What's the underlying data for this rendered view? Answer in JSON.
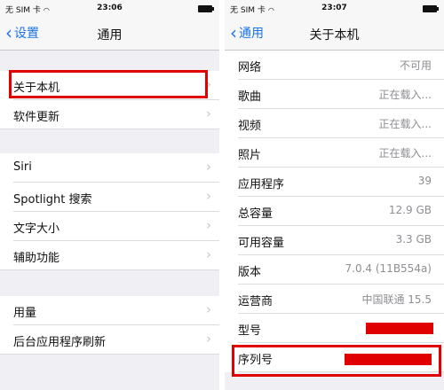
{
  "left": {
    "status": {
      "carrier": "无 SIM 卡",
      "time": "23:06"
    },
    "nav": {
      "back": "设置",
      "title": "通用"
    },
    "rows": {
      "about": "关于本机",
      "software_update": "软件更新",
      "siri": "Siri",
      "spotlight": "Spotlight 搜索",
      "text_size": "文字大小",
      "accessibility": "辅助功能",
      "usage": "用量",
      "bg_refresh": "后台应用程序刷新"
    }
  },
  "right": {
    "status": {
      "carrier": "无 SIM 卡",
      "time": "23:07"
    },
    "nav": {
      "back": "通用",
      "title": "关于本机"
    },
    "rows": [
      {
        "label": "网络",
        "value": "不可用"
      },
      {
        "label": "歌曲",
        "value": "正在载入..."
      },
      {
        "label": "视频",
        "value": "正在载入..."
      },
      {
        "label": "照片",
        "value": "正在载入..."
      },
      {
        "label": "应用程序",
        "value": "39"
      },
      {
        "label": "总容量",
        "value": "12.9 GB"
      },
      {
        "label": "可用容量",
        "value": "3.3 GB"
      },
      {
        "label": "版本",
        "value": "7.0.4 (11B554a)"
      },
      {
        "label": "运营商",
        "value": "中国联通 15.5"
      },
      {
        "label": "型号",
        "value": ""
      },
      {
        "label": "序列号",
        "value": ""
      }
    ]
  },
  "colors": {
    "accent": "#1a73e8",
    "highlight": "#e00000"
  }
}
